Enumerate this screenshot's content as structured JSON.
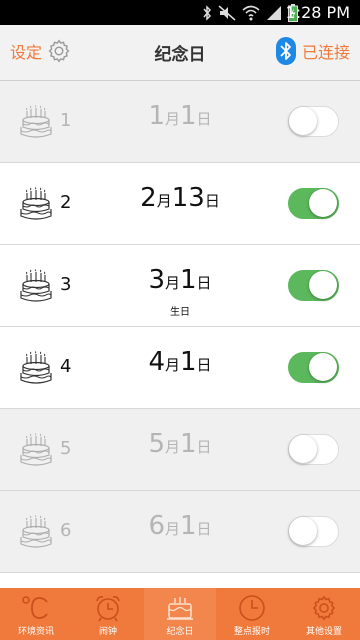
{
  "status": {
    "time": "1:28 PM"
  },
  "header": {
    "settings_label": "设定",
    "title": "纪念日",
    "connection_label": "已连接"
  },
  "rows": [
    {
      "index": "1",
      "month": "1",
      "month_unit": "月",
      "day": "1",
      "day_unit": "日",
      "note": "",
      "enabled": false
    },
    {
      "index": "2",
      "month": "2",
      "month_unit": "月",
      "day": "13",
      "day_unit": "日",
      "note": "",
      "enabled": true
    },
    {
      "index": "3",
      "month": "3",
      "month_unit": "月",
      "day": "1",
      "day_unit": "日",
      "note": "生日",
      "enabled": true
    },
    {
      "index": "4",
      "month": "4",
      "month_unit": "月",
      "day": "1",
      "day_unit": "日",
      "note": "",
      "enabled": true
    },
    {
      "index": "5",
      "month": "5",
      "month_unit": "月",
      "day": "1",
      "day_unit": "日",
      "note": "",
      "enabled": false
    },
    {
      "index": "6",
      "month": "6",
      "month_unit": "月",
      "day": "1",
      "day_unit": "日",
      "note": "",
      "enabled": false
    }
  ],
  "tabs": [
    {
      "label": "环境资讯",
      "icon": "celsius-icon"
    },
    {
      "label": "闹钟",
      "icon": "alarm-clock-icon"
    },
    {
      "label": "纪念日",
      "icon": "cake-icon"
    },
    {
      "label": "整点报时",
      "icon": "clock-icon"
    },
    {
      "label": "其他设置",
      "icon": "gear-icon"
    }
  ],
  "colors": {
    "accent": "#f07a3c",
    "toggle_on": "#5cb85c",
    "disabled_row": "#f0f0f0"
  }
}
